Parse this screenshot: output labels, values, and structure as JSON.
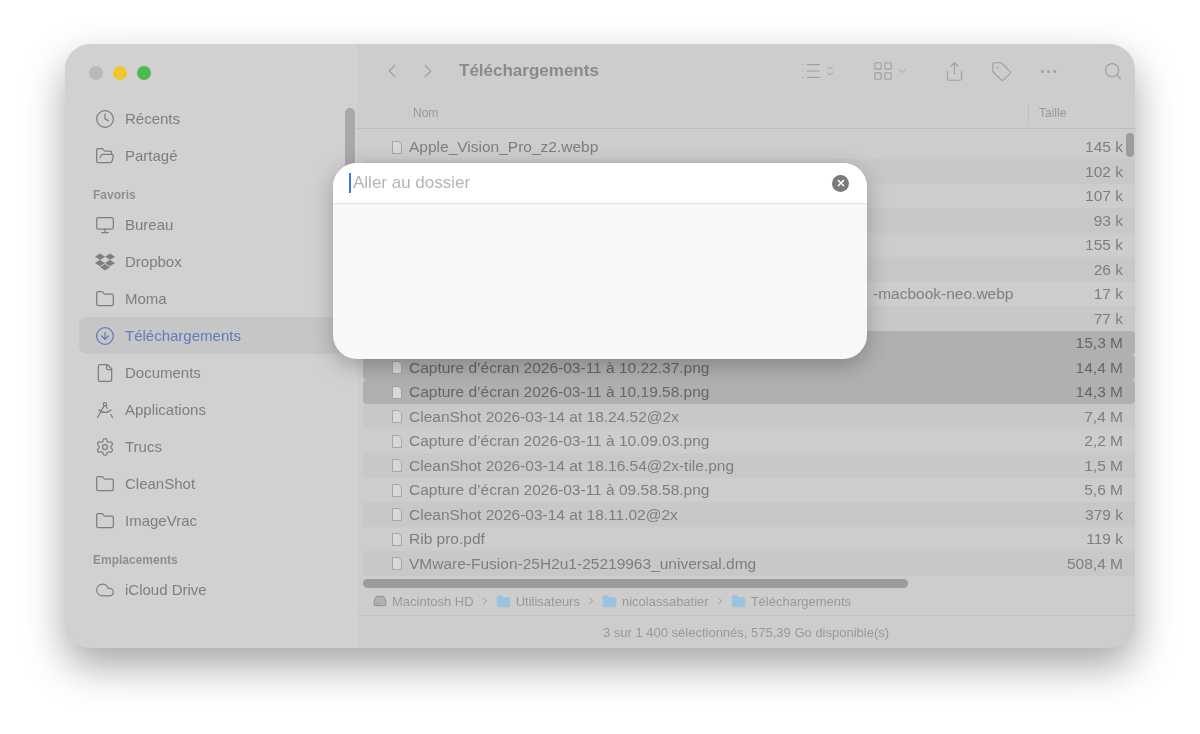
{
  "sidebar": {
    "sections": [
      {
        "items": [
          {
            "label": "Récents",
            "kind": "clock",
            "selected": false
          },
          {
            "label": "Partagé",
            "kind": "shared",
            "selected": false
          }
        ]
      },
      {
        "header": "Favoris",
        "items": [
          {
            "label": "Bureau",
            "kind": "desktop",
            "selected": false
          },
          {
            "label": "Dropbox",
            "kind": "dropbox",
            "selected": false
          },
          {
            "label": "Moma",
            "kind": "folder",
            "selected": false
          },
          {
            "label": "Téléchargements",
            "kind": "download",
            "selected": true
          },
          {
            "label": "Documents",
            "kind": "document",
            "selected": false
          },
          {
            "label": "Applications",
            "kind": "apps",
            "selected": false
          },
          {
            "label": "Trucs",
            "kind": "gear",
            "selected": false
          },
          {
            "label": "CleanShot",
            "kind": "folder",
            "selected": false
          },
          {
            "label": "ImageVrac",
            "kind": "folder",
            "selected": false
          }
        ]
      },
      {
        "header": "Emplacements",
        "items": [
          {
            "label": "iCloud Drive",
            "kind": "cloud",
            "selected": false
          }
        ]
      }
    ]
  },
  "toolbar": {
    "title": "Téléchargements"
  },
  "columns": [
    "Nom",
    "Taille"
  ],
  "rows": [
    {
      "kind": "file",
      "name": "Apple_Vision_Pro_z2.webp",
      "size": "145 k",
      "selected": false
    },
    {
      "kind": "covered",
      "size": "102 k",
      "selected": false
    },
    {
      "kind": "covered",
      "size": "107 k",
      "selected": false
    },
    {
      "kind": "covered",
      "size": "93 k",
      "selected": false
    },
    {
      "kind": "covered",
      "size": "155 k",
      "selected": false
    },
    {
      "kind": "covered",
      "size": "26 k",
      "selected": false
    },
    {
      "kind": "covered",
      "name": "-macbook-neo.webp",
      "size": "17 k",
      "selected": false
    },
    {
      "kind": "covered",
      "size": "77 k",
      "selected": false
    },
    {
      "kind": "covered",
      "size": "15,3 M",
      "selected": true
    },
    {
      "kind": "file",
      "name": "Capture d’écran 2026-03-11 à 10.22.37.png",
      "size": "14,4 M",
      "selected": true
    },
    {
      "kind": "file",
      "name": "Capture d’écran 2026-03-11 à 10.19.58.png",
      "size": "14,3 M",
      "selected": true
    },
    {
      "kind": "file",
      "name": "CleanShot 2026-03-14 at 18.24.52@2x",
      "size": "7,4 M",
      "selected": false
    },
    {
      "kind": "file",
      "name": "Capture d’écran 2026-03-11 à 10.09.03.png",
      "size": "2,2 M",
      "selected": false
    },
    {
      "kind": "file",
      "name": "CleanShot 2026-03-14 at 18.16.54@2x-tile.png",
      "size": "1,5 M",
      "selected": false
    },
    {
      "kind": "file",
      "name": "Capture d’écran 2026-03-11 à 09.58.58.png",
      "size": "5,6 M",
      "selected": false
    },
    {
      "kind": "file",
      "name": "CleanShot 2026-03-14 at 18.11.02@2x",
      "size": "379 k",
      "selected": false
    },
    {
      "kind": "file",
      "name": "Rib pro.pdf",
      "size": "119 k",
      "selected": false
    },
    {
      "kind": "file",
      "name": "VMware-Fusion-25H2u1-25219963_universal.dmg",
      "size": "508,4 M",
      "selected": false
    }
  ],
  "path": [
    {
      "label": "Macintosh HD",
      "kind": "disk"
    },
    {
      "label": "Utilisateurs",
      "kind": "folder"
    },
    {
      "label": "nicolassabatier",
      "kind": "folder"
    },
    {
      "label": "Téléchargements",
      "kind": "folder"
    }
  ],
  "status": "3 sur 1 400 sélectionnés, 575,39 Go disponible(s)",
  "dialog": {
    "placeholder": "Aller au dossier"
  }
}
